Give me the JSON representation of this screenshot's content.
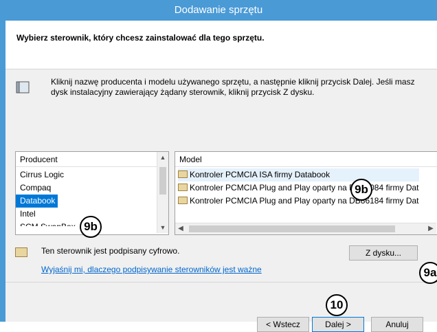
{
  "window": {
    "title": "Dodawanie sprzętu"
  },
  "header": {
    "title": "Wybierz sterownik, który chcesz zainstalować dla tego sprzętu."
  },
  "info": {
    "text": "Kliknij nazwę producenta i modelu używanego sprzętu, a następnie kliknij przycisk Dalej. Jeśli masz dysk instalacyjny zawierający żądany sterownik, kliknij przycisk Z dysku."
  },
  "manufacturer": {
    "header": "Producent",
    "items": [
      "Cirrus Logic",
      "Compaq",
      "Databook",
      "Intel",
      "SCM SwapBox"
    ],
    "selected": "Databook"
  },
  "model": {
    "header": "Model",
    "items": [
      "Kontroler PCMCIA ISA firmy Databook",
      "Kontroler PCMCIA Plug and Play oparty na DB86084 firmy Dat",
      "Kontroler PCMCIA Plug and Play oparty na DB86184 firmy Dat"
    ]
  },
  "signature": {
    "text": "Ten sterownik jest podpisany cyfrowo.",
    "link": "Wyjaśnij mi, dlaczego podpisywanie sterowników jest ważne"
  },
  "buttons": {
    "have_disk": "Z dysku...",
    "back": "< Wstecz",
    "next": "Dalej >",
    "cancel": "Anuluj"
  },
  "callouts": {
    "c9b": "9b",
    "c9a": "9a",
    "c10": "10"
  }
}
